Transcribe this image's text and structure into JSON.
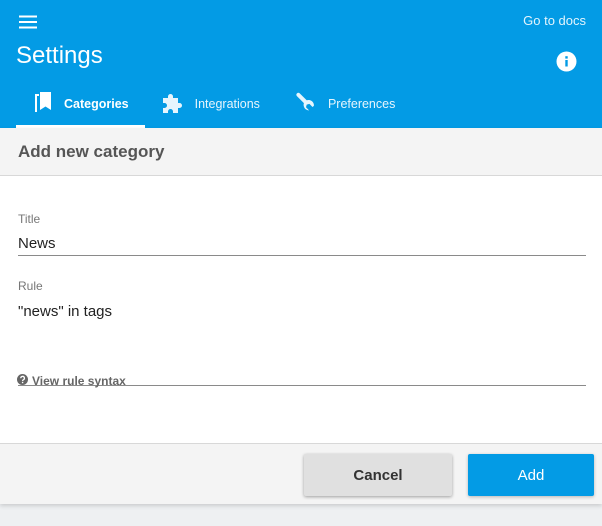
{
  "header": {
    "title": "Settings",
    "docs_link": "Go to docs",
    "menu_icon": "menu-icon",
    "info_icon": "info-icon",
    "tabs": [
      {
        "label": "Categories",
        "icon": "bookmarks-icon",
        "active": true
      },
      {
        "label": "Integrations",
        "icon": "puzzle-icon",
        "active": false
      },
      {
        "label": "Preferences",
        "icon": "wrench-icon",
        "active": false
      }
    ]
  },
  "form": {
    "heading": "Add new category",
    "title_label": "Title",
    "title_value": "News",
    "rule_label": "Rule",
    "rule_value": "\"news\" in tags",
    "syntax_link": "View rule syntax",
    "cancel_label": "Cancel",
    "add_label": "Add"
  },
  "colors": {
    "accent": "#039be5",
    "header_text": "#ffffff",
    "cancel_bg": "#e0e0e0"
  }
}
